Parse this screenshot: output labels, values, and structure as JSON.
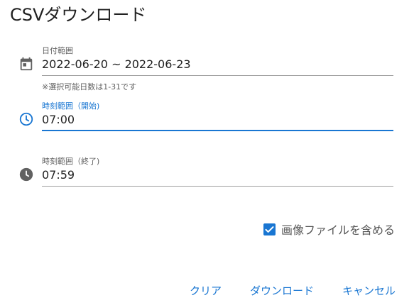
{
  "dialog": {
    "title": "CSVダウンロード"
  },
  "date_range": {
    "label": "日付範囲",
    "value": "2022-06-20 ~ 2022-06-23",
    "hint": "※選択可能日数は1-31です",
    "icon": "calendar-icon"
  },
  "time_start": {
    "label": "時刻範囲（開始)",
    "value": "07:00",
    "icon": "clock-outline-icon"
  },
  "time_end": {
    "label": "時刻範囲（終了)",
    "value": "07:59",
    "icon": "clock-filled-icon"
  },
  "include_images": {
    "label": "画像ファイルを含める",
    "checked": true
  },
  "actions": {
    "clear": "クリア",
    "download": "ダウンロード",
    "cancel": "キャンセル"
  },
  "colors": {
    "accent": "#1976d2",
    "icon": "#616161",
    "text": "#212121"
  }
}
